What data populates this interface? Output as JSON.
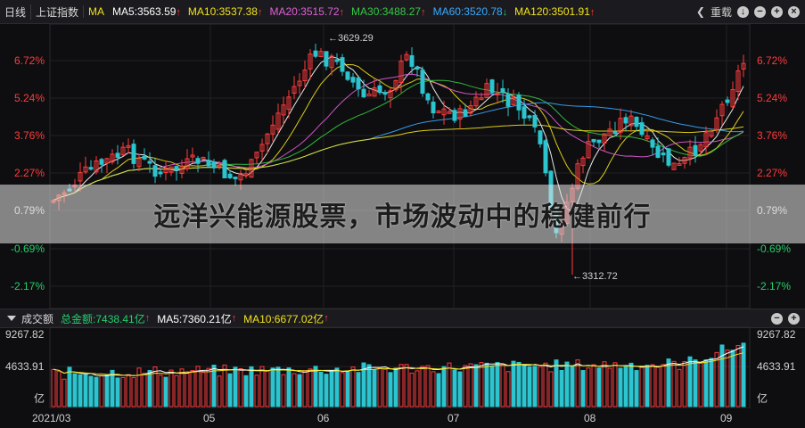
{
  "top_bar": {
    "period": "日线",
    "index_name": "上证指数",
    "ma_label": "MA",
    "ma": [
      {
        "label": "MA5:3563.59",
        "color": "#ffffff",
        "dir": "up"
      },
      {
        "label": "MA10:3537.38",
        "color": "#f2e21a",
        "dir": "up"
      },
      {
        "label": "MA20:3515.72",
        "color": "#e05fd6",
        "dir": "up"
      },
      {
        "label": "MA30:3488.27",
        "color": "#35c843",
        "dir": "up"
      },
      {
        "label": "MA60:3520.78",
        "color": "#3aa9ff",
        "dir": "down"
      },
      {
        "label": "MA120:3501.91",
        "color": "#f2e21a",
        "dir": "up"
      }
    ],
    "reset_label": "重载",
    "icons": [
      "left-arrow-icon",
      "download-icon",
      "minus-icon",
      "plus-icon",
      "close-icon"
    ]
  },
  "price_axis": {
    "labels": [
      "6.72%",
      "5.24%",
      "3.76%",
      "2.27%",
      "0.79%",
      "-0.69%",
      "-2.17%"
    ],
    "positive_color": "#ff3b3b",
    "negative_color": "#22d06a",
    "neutral_color": "#cfcfcf"
  },
  "annotations": {
    "high": "←3629.29",
    "low": "←3312.72"
  },
  "overlay": {
    "title": "远洋兴能源股票，市场波动中的稳健前行"
  },
  "volume_bar": {
    "label": "成交额",
    "total_label": "总金额:7438.41亿",
    "ma5_label": "MA5:7360.21亿",
    "ma10_label": "MA10:6677.02亿"
  },
  "volume_axis": {
    "labels": [
      "9267.82",
      "4633.91",
      "亿"
    ]
  },
  "date_axis": {
    "labels": [
      "2021/03",
      "05",
      "06",
      "07",
      "08",
      "09"
    ]
  },
  "colors": {
    "up": "#ff3b3b",
    "down": "#2bc4cf",
    "background": "#0e0e10"
  }
}
